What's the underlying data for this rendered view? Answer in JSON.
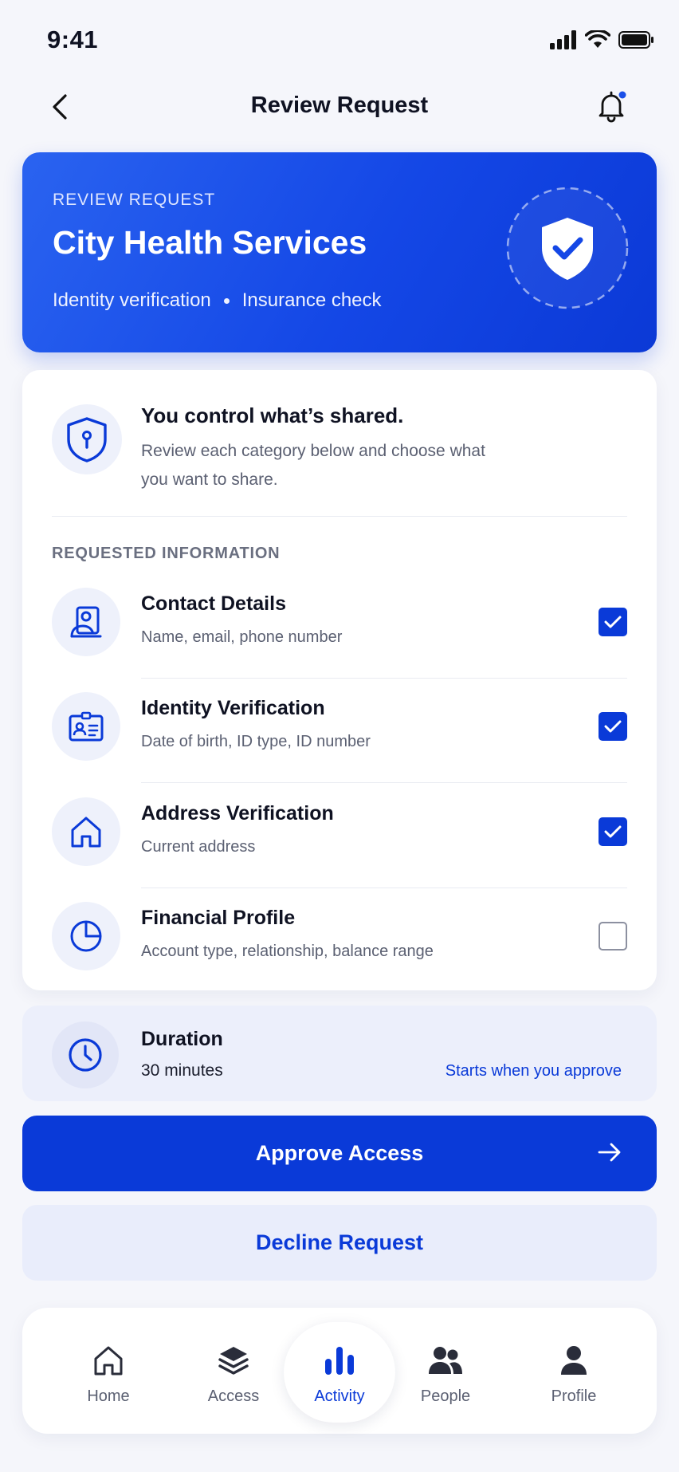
{
  "status_bar": {
    "time": "9:41"
  },
  "header": {
    "title": "Review Request"
  },
  "hero": {
    "eyebrow": "REVIEW REQUEST",
    "organization": "City Health Services",
    "purposes": [
      "Identity verification",
      "Insurance check"
    ],
    "color": "#1447e6"
  },
  "intro": {
    "title": "You control what’s shared.",
    "description": "Review each category below and choose what you want to share."
  },
  "requested": {
    "section_label": "REQUESTED INFORMATION",
    "items": [
      {
        "title": "Contact Details",
        "description": "Name, email, phone number",
        "checked": true,
        "icon": "contact-icon"
      },
      {
        "title": "Identity Verification",
        "description": "Date of birth, ID type, ID number",
        "checked": true,
        "icon": "id-card-icon"
      },
      {
        "title": "Address Verification",
        "description": "Current address",
        "checked": true,
        "icon": "home-icon"
      },
      {
        "title": "Financial Profile",
        "description": "Account type, relationship, balance range",
        "checked": false,
        "icon": "pie-chart-icon"
      }
    ]
  },
  "duration": {
    "title": "Duration",
    "value": "30 minutes",
    "note": "Starts when you approve"
  },
  "actions": {
    "approve_label": "Approve Access",
    "decline_label": "Decline Request"
  },
  "tabbar": {
    "active": "Activity",
    "tabs": [
      {
        "label": "Home",
        "icon": "home-icon"
      },
      {
        "label": "Access",
        "icon": "layers-icon"
      },
      {
        "label": "Activity",
        "icon": "bar-chart-icon"
      },
      {
        "label": "People",
        "icon": "people-icon"
      },
      {
        "label": "Profile",
        "icon": "person-icon"
      }
    ]
  },
  "colors": {
    "accent": "#0a3ad8",
    "background": "#f5f6fb",
    "notification_dot": "#1a4fe8"
  }
}
